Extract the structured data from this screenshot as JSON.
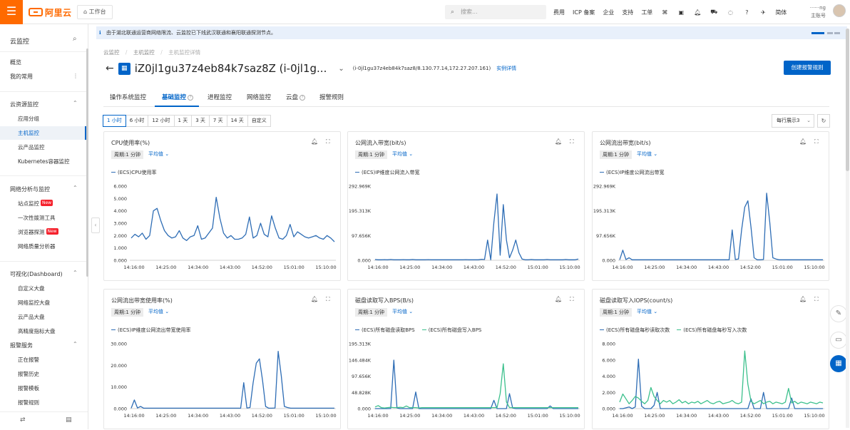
{
  "topbar": {
    "logo": "阿里云",
    "workbench": "工作台",
    "search_placeholder": "搜索...",
    "nav": [
      "费用",
      "ICP 备案",
      "企业",
      "支持",
      "工单"
    ],
    "lang": "简体",
    "user_line1": "······ng",
    "user_line2": "主账号"
  },
  "sidebar": {
    "title": "云监控",
    "top_items": [
      "概览",
      "我的常用"
    ],
    "groups": [
      {
        "title": "云资源监控",
        "items": [
          "应用分组",
          "主机监控",
          "云产品监控",
          "Kubernetes容器监控"
        ]
      },
      {
        "title": "网络分析与监控",
        "items": [
          "站点监控",
          "一次性拨测工具",
          "浏览器探测",
          "网络质量分析器"
        ]
      },
      {
        "title": "可视化(Dashboard)",
        "items": [
          "自定义大盘",
          "网络监控大盘",
          "云产品大盘",
          "高精度指标大盘"
        ]
      },
      {
        "title": "报警服务",
        "items": [
          "正在报警",
          "报警历史",
          "报警模板",
          "报警规则"
        ]
      }
    ],
    "badges": {
      "new": "New"
    }
  },
  "banner": {
    "text": "由于湖北联通运营商网络限流、云监控已下线武汉联通和襄阳联通探测节点。"
  },
  "breadcrumb": [
    "云监控",
    "主机监控",
    "主机监控详情"
  ],
  "page": {
    "title": "iZ0jl1gu37z4eb84k7saz8Z (i-0jl1g...",
    "subtitle": "(i-0jl1gu37z4eb84k7saz8/8.130.77.14,172.27.207.161)",
    "detail_link": "实例详情",
    "create_button": "创建报警规则"
  },
  "tabs": [
    "操作系统监控",
    "基础监控",
    "进程监控",
    "网络监控",
    "云盘",
    "报警规则"
  ],
  "active_tab": 1,
  "ranges": [
    "1 小时",
    "6 小时",
    "12 小时",
    "1 天",
    "3 天",
    "7 天",
    "14 天",
    "自定义"
  ],
  "active_range": 0,
  "per_row": "每行展示3",
  "chart_data": [
    {
      "type": "line",
      "title": "CPU使用率(%)",
      "period": "周期:1 分钟",
      "agg": "平均值",
      "x": [
        "14:16:00",
        "14:25:00",
        "14:34:00",
        "14:43:00",
        "14:52:00",
        "15:01:00",
        "15:10:00"
      ],
      "ylim": [
        0,
        6
      ],
      "yticks": [
        "6.000",
        "5.000",
        "4.000",
        "3.000",
        "2.000",
        "1.000",
        "0.000"
      ],
      "series": [
        {
          "name": "(ECS)CPU使用率",
          "color": "#2e6db5",
          "values": [
            1.8,
            2.1,
            1.9,
            2.2,
            1.7,
            2.0,
            4.0,
            4.2,
            3.2,
            2.4,
            2.0,
            1.8,
            1.9,
            2.4,
            1.8,
            1.6,
            1.9,
            2.0,
            2.8,
            1.7,
            1.8,
            2.2,
            2.6,
            5.1,
            3.4,
            2.2,
            1.8,
            2.0,
            1.7,
            1.7,
            1.8,
            2.1,
            3.5,
            1.8,
            2.0,
            3.0,
            2.1,
            1.9,
            3.6,
            2.6,
            1.8,
            1.7,
            2.0,
            2.9,
            1.9,
            2.3,
            2.1,
            1.9,
            1.8,
            1.9,
            2.0,
            1.8,
            1.7,
            2.0,
            1.8,
            1.5
          ]
        }
      ]
    },
    {
      "type": "line",
      "title": "公网流入带宽(bit/s)",
      "period": "周期:1 分钟",
      "agg": "平均值",
      "x": [
        "14:16:00",
        "14:25:00",
        "14:34:00",
        "14:43:00",
        "14:52:00",
        "15:01:00",
        "15:10:00"
      ],
      "ylim": [
        0,
        292969
      ],
      "yticks": [
        "292.969K",
        "195.313K",
        "97.656K",
        "0.000"
      ],
      "series": [
        {
          "name": "(ECS)IP维度公网流入带宽",
          "color": "#2e6db5",
          "values": [
            3000,
            2000,
            2000,
            2500,
            2000,
            3000,
            2000,
            2000,
            2000,
            2500,
            2000,
            2000,
            3000,
            2000,
            2000,
            2000,
            2000,
            2500,
            2000,
            2000,
            2000,
            2000,
            2000,
            2000,
            2000,
            2000,
            2000,
            2000,
            2000,
            2500,
            2000,
            2000,
            2000,
            2000,
            4000,
            3000,
            80000,
            2000,
            150000,
            262000,
            20000,
            220000,
            80000,
            10000,
            40000,
            80000,
            30000,
            5000,
            2000,
            2000,
            3000,
            2000,
            2000,
            2000,
            2000,
            3000,
            2000,
            2000,
            2000,
            2000,
            2000,
            3000,
            2000,
            2000,
            2000,
            5000
          ]
        }
      ]
    },
    {
      "type": "line",
      "title": "公网流出带宽(bit/s)",
      "period": "周期:1 分钟",
      "agg": "平均值",
      "x": [
        "14:16:00",
        "14:25:00",
        "14:34:00",
        "14:43:00",
        "14:52:00",
        "15:01:00",
        "15:10:00"
      ],
      "ylim": [
        0,
        292969
      ],
      "yticks": [
        "292.969K",
        "195.313K",
        "97.656K",
        "0.000"
      ],
      "series": [
        {
          "name": "(ECS)IP维度公网流出带宽",
          "color": "#2e6db5",
          "values": [
            2000,
            40000,
            3000,
            10000,
            2000,
            2000,
            2000,
            2000,
            2000,
            2000,
            2000,
            2000,
            2000,
            2000,
            2000,
            2000,
            2000,
            2000,
            2000,
            2000,
            2000,
            2000,
            2000,
            2000,
            2000,
            2000,
            2000,
            2000,
            2000,
            2000,
            2000,
            2000,
            2000,
            2000,
            2000,
            2000,
            120000,
            3000,
            5000,
            120000,
            210000,
            235000,
            130000,
            10000,
            2000,
            2000,
            3000,
            265000,
            150000,
            10000,
            5000,
            2000,
            2000,
            2000,
            2000,
            2000,
            2000,
            2000,
            2000,
            2000,
            2000,
            2000,
            2000,
            2000,
            2000,
            2000
          ]
        }
      ]
    },
    {
      "type": "line",
      "title": "公网流出带宽使用率(%)",
      "period": "周期:1 分钟",
      "agg": "平均值",
      "x": [
        "14:16:00",
        "14:25:00",
        "14:34:00",
        "14:43:00",
        "14:52:00",
        "15:01:00",
        "15:10:00"
      ],
      "ylim": [
        0,
        30
      ],
      "yticks": [
        "30.000",
        "20.000",
        "10.000",
        "0.000"
      ],
      "series": [
        {
          "name": "(ECS)IP维度公网流出带宽使用率",
          "color": "#2e6db5",
          "values": [
            0.2,
            4.0,
            0.3,
            1.0,
            0.2,
            0.2,
            0.2,
            0.2,
            0.2,
            0.2,
            0.2,
            0.2,
            0.2,
            0.2,
            0.2,
            0.2,
            0.2,
            0.2,
            0.2,
            0.2,
            0.2,
            0.2,
            0.2,
            0.2,
            0.2,
            0.2,
            0.2,
            0.2,
            0.2,
            0.2,
            0.2,
            0.2,
            0.2,
            0.2,
            0.2,
            0.2,
            12.0,
            0.3,
            0.5,
            12.0,
            21.0,
            23.0,
            13.0,
            1.0,
            0.2,
            0.2,
            0.3,
            26.5,
            15.0,
            1.0,
            0.5,
            0.2,
            0.2,
            0.2,
            0.2,
            0.2,
            0.2,
            0.2,
            0.2,
            0.2,
            0.2,
            0.2,
            0.2,
            0.2,
            0.2,
            0.2
          ]
        }
      ]
    },
    {
      "type": "line",
      "title": "磁盘读取写入BPS(B/s)",
      "period": "周期:1 分钟",
      "agg": "平均值",
      "x": [
        "14:16:00",
        "14:25:00",
        "14:34:00",
        "14:43:00",
        "14:52:00",
        "15:01:00",
        "15:10:00"
      ],
      "ylim": [
        0,
        195313
      ],
      "yticks": [
        "195.313K",
        "146.484K",
        "97.656K",
        "48.828K",
        "0.000"
      ],
      "series": [
        {
          "name": "(ECS)所有磁盘读取BPS",
          "color": "#2e6db5",
          "values": [
            0,
            0,
            0,
            0,
            0,
            500,
            146000,
            2000,
            0,
            0,
            0,
            0,
            0,
            50000,
            0,
            0,
            0,
            0,
            0,
            0,
            0,
            0,
            0,
            0,
            0,
            0,
            0,
            0,
            0,
            0,
            0,
            0,
            0,
            0,
            0,
            0,
            0,
            0,
            25000,
            0,
            0,
            0,
            0,
            45000,
            2000,
            0,
            0,
            0,
            0,
            0,
            0,
            0,
            0,
            0,
            0,
            0,
            8000,
            0,
            0,
            0,
            0,
            0,
            0,
            0,
            0,
            0
          ]
        },
        {
          "name": "(ECS)所有磁盘写入BPS",
          "color": "#3cc08c",
          "values": [
            5000,
            9000,
            3000,
            2000,
            3000,
            4000,
            3000,
            3000,
            4000,
            3000,
            8000,
            3000,
            3000,
            3000,
            2000,
            3000,
            3000,
            3000,
            3000,
            3000,
            3000,
            3000,
            3000,
            3000,
            3000,
            3000,
            3000,
            3000,
            3000,
            3000,
            3000,
            3000,
            3000,
            3000,
            3000,
            3000,
            3000,
            3000,
            3000,
            3000,
            45000,
            135000,
            20000,
            3000,
            3000,
            3000,
            3000,
            3000,
            3000,
            3000,
            3000,
            3000,
            3000,
            3000,
            3000,
            3000,
            3000,
            3000,
            3000,
            3000,
            3000,
            3000,
            3000,
            3000,
            3000,
            3000
          ]
        }
      ]
    },
    {
      "type": "line",
      "title": "磁盘读取写入IOPS(count/s)",
      "period": "周期:1 分钟",
      "agg": "平均值",
      "x": [
        "14:16:00",
        "14:25:00",
        "14:34:00",
        "14:43:00",
        "14:52:00",
        "15:01:00",
        "15:10:00"
      ],
      "ylim": [
        0,
        8
      ],
      "yticks": [
        "8.000",
        "6.000",
        "4.000",
        "2.000",
        "0.000"
      ],
      "series": [
        {
          "name": "(ECS)所有磁盘每秒读取次数",
          "color": "#2e6db5",
          "values": [
            0,
            0,
            0.1,
            0.2,
            0,
            0.2,
            6.1,
            0.3,
            0,
            0,
            0,
            0.4,
            2.0,
            0,
            0,
            0,
            0,
            0,
            0,
            0,
            0,
            0,
            0,
            0,
            0,
            0,
            0,
            0,
            0,
            0,
            0,
            0,
            0,
            0,
            0,
            0,
            0,
            0,
            0,
            0,
            0,
            0,
            1.2,
            0,
            0,
            0,
            2.0,
            0,
            0,
            0,
            0,
            0,
            0,
            0,
            0,
            1.3,
            0,
            0,
            0,
            0,
            0,
            0,
            0,
            0,
            0,
            0
          ]
        },
        {
          "name": "(ECS)所有磁盘每秒写入次数",
          "color": "#3cc08c",
          "values": [
            0.8,
            1.8,
            1.2,
            0.6,
            1.0,
            1.5,
            1.3,
            0.9,
            0.6,
            1.0,
            2.6,
            1.5,
            1.0,
            0.6,
            1.0,
            0.8,
            1.0,
            0.6,
            0.8,
            1.1,
            0.7,
            0.9,
            0.6,
            0.8,
            0.7,
            0.9,
            0.6,
            0.8,
            1.0,
            0.7,
            0.6,
            0.8,
            0.9,
            0.6,
            0.7,
            0.8,
            1.0,
            0.7,
            0.6,
            0.8,
            7.1,
            3.0,
            0.9,
            0.6,
            0.8,
            1.0,
            0.6,
            0.8,
            0.9,
            0.6,
            0.8,
            0.7,
            0.6,
            0.8,
            2.5,
            0.7,
            0.9,
            0.6,
            0.8,
            0.7,
            0.6,
            0.8,
            0.7,
            0.6,
            0.8,
            0.7
          ]
        }
      ]
    }
  ]
}
